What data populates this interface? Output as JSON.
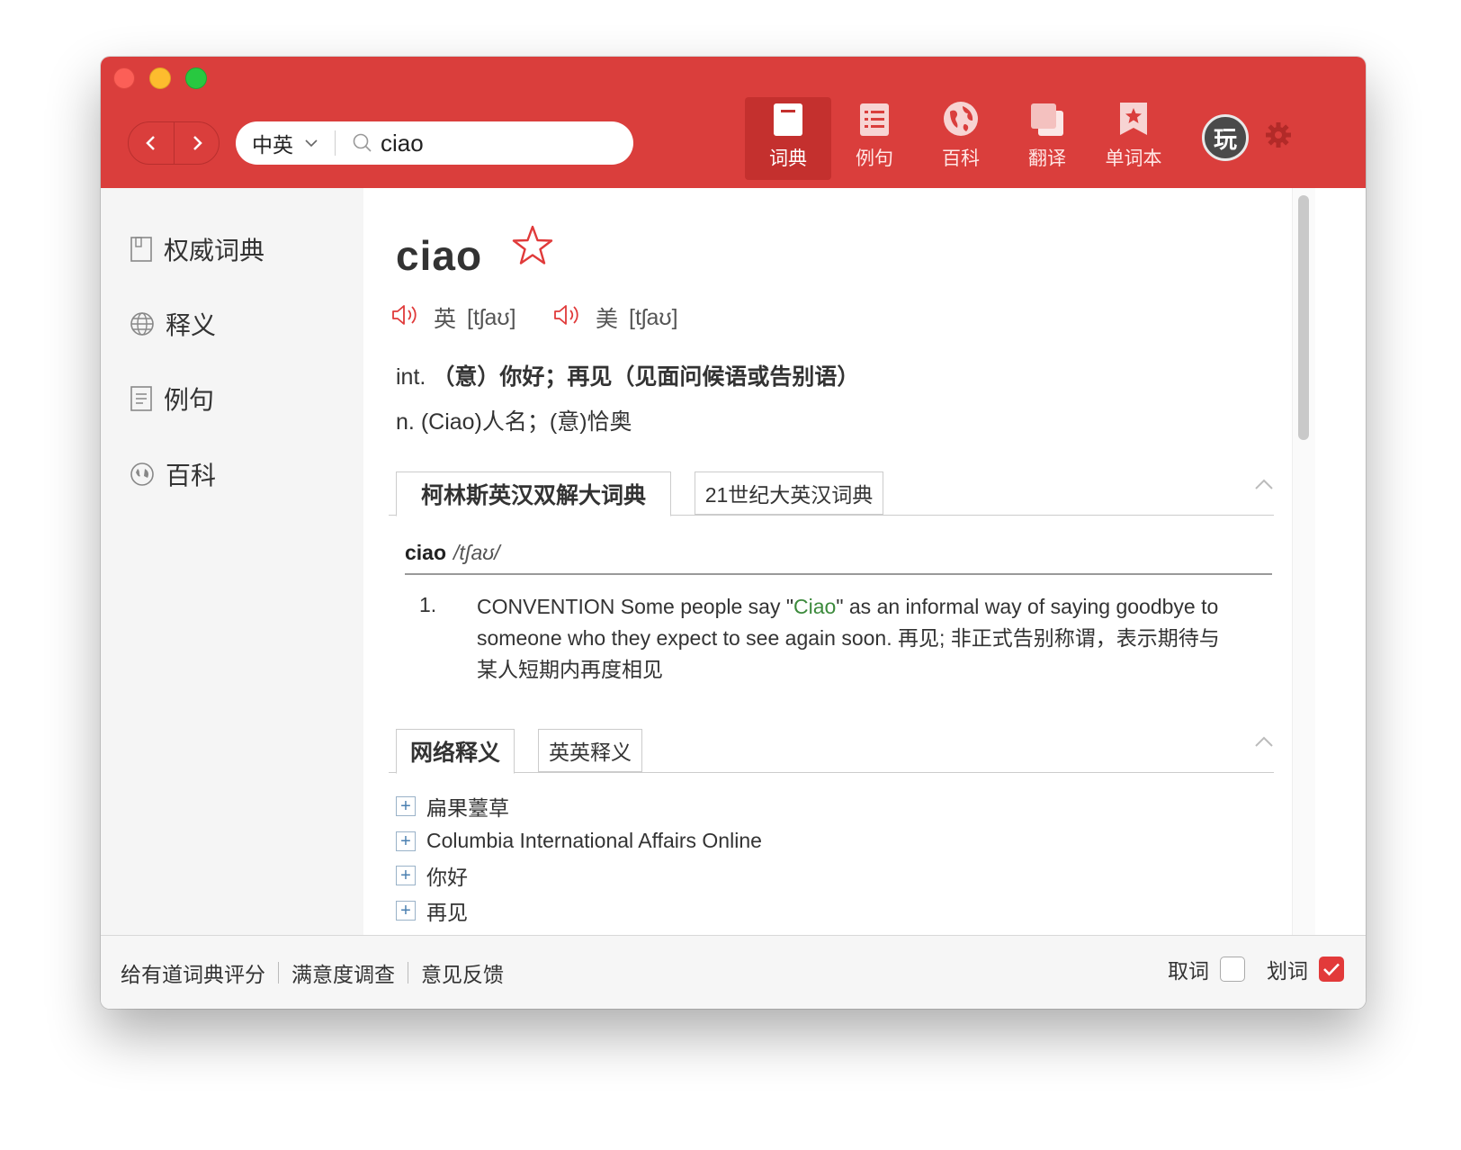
{
  "toolbar": {
    "lang_selector": "中英",
    "search_value": "ciao",
    "tabs": [
      {
        "label": "词典",
        "icon": "dictionary-icon"
      },
      {
        "label": "例句",
        "icon": "list-icon"
      },
      {
        "label": "百科",
        "icon": "globe-icon"
      },
      {
        "label": "翻译",
        "icon": "translate-icon"
      },
      {
        "label": "单词本",
        "icon": "bookmark-icon"
      }
    ],
    "avatar_text": "玩",
    "accent_color": "#da3e3c"
  },
  "sidebar": {
    "items": [
      {
        "label": "权威词典",
        "icon": "book-icon"
      },
      {
        "label": "释义",
        "icon": "globe-icon"
      },
      {
        "label": "例句",
        "icon": "document-icon"
      },
      {
        "label": "百科",
        "icon": "compass-icon"
      }
    ]
  },
  "entry": {
    "word": "ciao",
    "uk_label": "英",
    "uk_phonetic": "[tʃaʊ]",
    "us_label": "美",
    "us_phonetic": "[tʃaʊ]",
    "definitions": [
      {
        "pos": "int.",
        "text": "（意）你好；再见（见面问候语或告别语）"
      },
      {
        "pos": "n.",
        "text": "(Ciao)人名；(意)恰奥"
      }
    ]
  },
  "collins": {
    "tabs": [
      "柯林斯英汉双解大词典",
      "21世纪大英汉词典"
    ],
    "headword": "ciao",
    "phonetic": "/tʃaʊ/",
    "sense_number": "1.",
    "sense_before": "CONVENTION Some people say \"",
    "sense_highlight": "Ciao",
    "sense_after": "\" as an informal way of saying goodbye to someone who they expect to see again soon. 再见; 非正式告别称谓，表示期待与某人短期内再度相见"
  },
  "web": {
    "tabs": [
      "网络释义",
      "英英释义"
    ],
    "items": [
      "扁果薹草",
      "Columbia International Affairs Online",
      "你好",
      "再见"
    ]
  },
  "footer": {
    "links": [
      "给有道词典评分",
      "满意度调查",
      "意见反馈"
    ],
    "option_quci": "取词",
    "option_huaci": "划词",
    "quci_checked": false,
    "huaci_checked": true
  }
}
